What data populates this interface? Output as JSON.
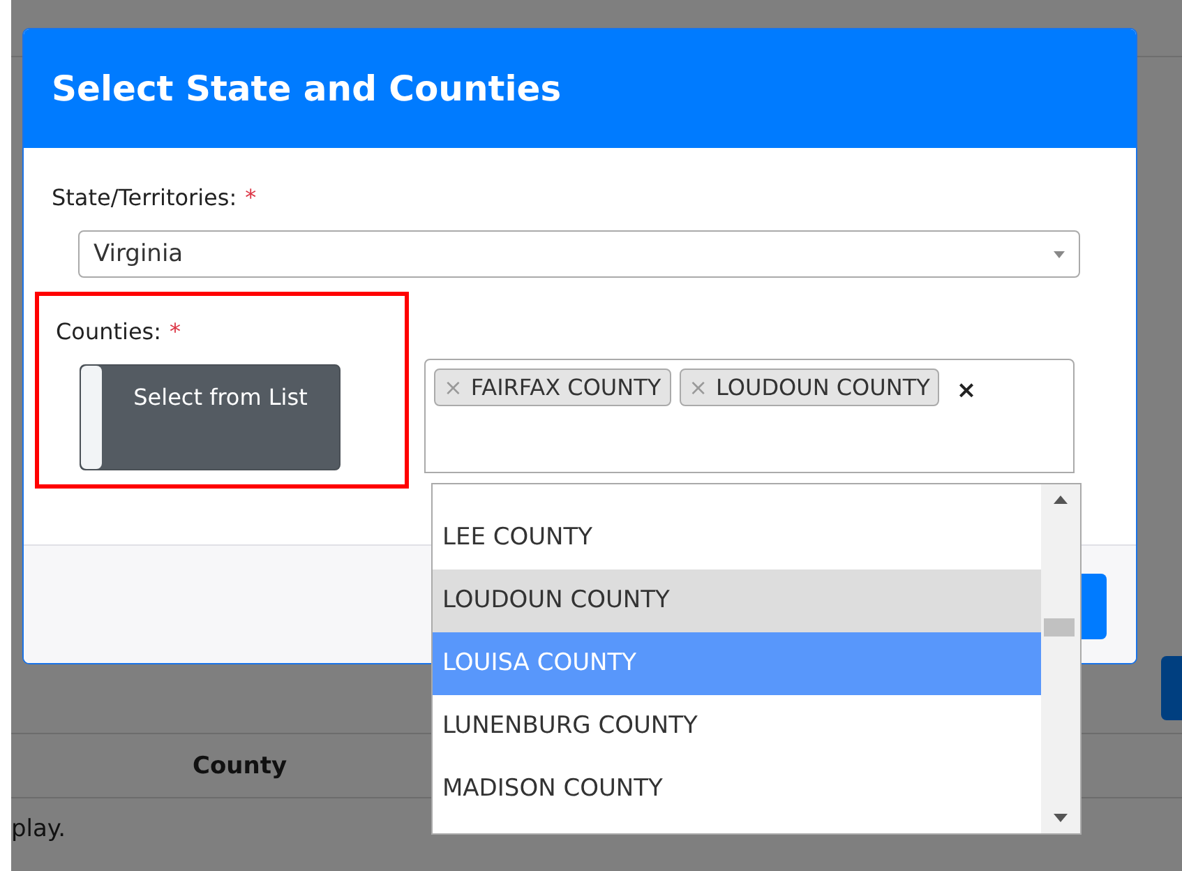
{
  "background": {
    "column_header": "County",
    "message": "play."
  },
  "modal": {
    "title": "Select State and Counties",
    "state_field": {
      "label": "State/Territories:",
      "required_mark": "*",
      "value": "Virginia"
    },
    "counties_field": {
      "label": "Counties:",
      "required_mark": "*",
      "highlighted": true,
      "toggle_button": {
        "label": "Select from List",
        "on": false
      },
      "tags": [
        {
          "remove": "×",
          "label": "FAIRFAX COUNTY"
        },
        {
          "remove": "×",
          "label": "LOUDOUN COUNTY"
        }
      ],
      "clear": "×",
      "options": [
        {
          "label": "LEE COUNTY",
          "selected": false,
          "highlighted": false
        },
        {
          "label": "LOUDOUN COUNTY",
          "selected": true,
          "highlighted": false
        },
        {
          "label": "LOUISA COUNTY",
          "selected": false,
          "highlighted": true
        },
        {
          "label": "LUNENBURG COUNTY",
          "selected": false,
          "highlighted": false
        },
        {
          "label": "MADISON COUNTY",
          "selected": false,
          "highlighted": false
        }
      ]
    }
  }
}
